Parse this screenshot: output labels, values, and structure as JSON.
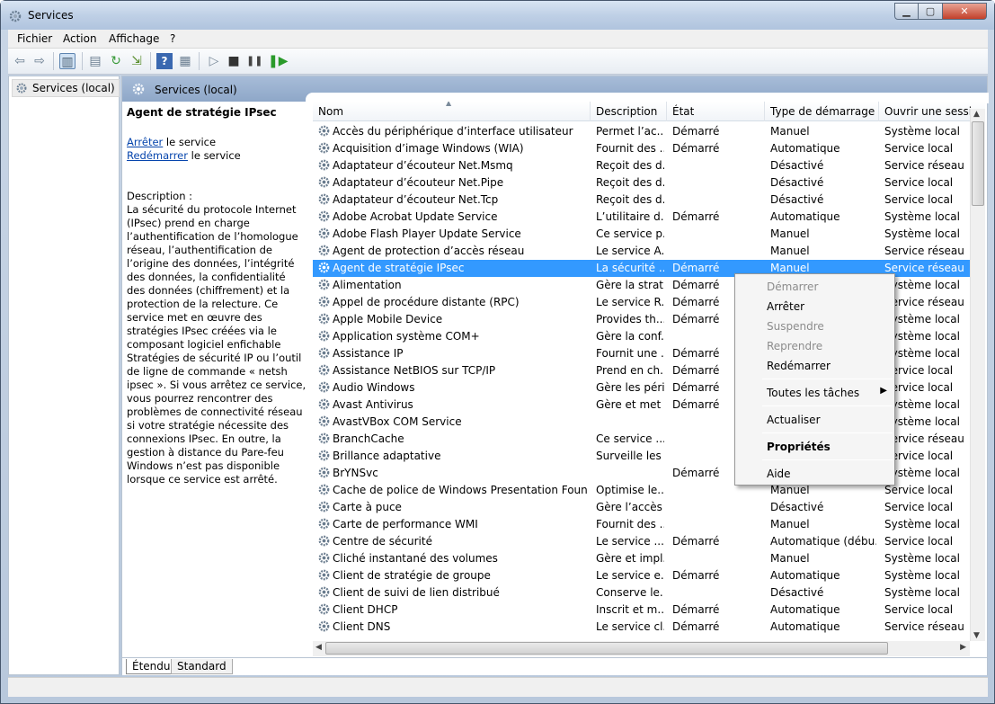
{
  "window": {
    "title": "Services",
    "icon": "gear-icon"
  },
  "menu": [
    "Fichier",
    "Action",
    "Affichage",
    "?"
  ],
  "toolbar": {
    "buttons": [
      "back-arrow-icon",
      "forward-arrow-icon",
      "console-tree-icon",
      "properties-icon",
      "refresh-icon",
      "export-icon",
      "help-icon",
      "view-icon",
      "play-icon",
      "stop-icon",
      "pause-icon",
      "restart-icon"
    ]
  },
  "tree": {
    "item": "Services (local)"
  },
  "pane_header": "Services (local)",
  "detail": {
    "title": "Agent de stratégie IPsec",
    "stop_link": "Arrêter",
    "stop_suffix": " le service",
    "restart_link": "Redémarrer",
    "restart_suffix": " le service",
    "description_label": "Description :",
    "description": "La sécurité du protocole Internet (IPsec) prend en charge l’authentification de l’homologue réseau, l’authentification de l’origine des données, l’intégrité des données, la confidentialité des données (chiffrement) et la protection de la relecture. Ce service met en œuvre des stratégies IPsec créées via le composant logiciel enfichable Stratégies de sécurité IP ou l’outil de ligne de commande « netsh ipsec ». Si vous arrêtez ce service, vous pourrez rencontrer des problèmes de connectivité réseau si votre stratégie nécessite des connexions IPsec. En outre, la gestion à distance du Pare-feu Windows n’est pas disponible lorsque ce service est arrêté."
  },
  "columns": [
    "Nom",
    "Description",
    "État",
    "Type de démarrage",
    "Ouvrir une session"
  ],
  "rows": [
    {
      "name": "Accès du périphérique d’interface utilisateur",
      "desc": "Permet l’ac...",
      "state": "Démarré",
      "startup": "Manuel",
      "logon": "Système local"
    },
    {
      "name": "Acquisition d’image Windows (WIA)",
      "desc": "Fournit des ...",
      "state": "Démarré",
      "startup": "Automatique",
      "logon": "Service local"
    },
    {
      "name": "Adaptateur d’écouteur Net.Msmq",
      "desc": "Reçoit des d...",
      "state": "",
      "startup": "Désactivé",
      "logon": "Service réseau"
    },
    {
      "name": "Adaptateur d’écouteur Net.Pipe",
      "desc": "Reçoit des d...",
      "state": "",
      "startup": "Désactivé",
      "logon": "Service local"
    },
    {
      "name": "Adaptateur d’écouteur Net.Tcp",
      "desc": "Reçoit des d...",
      "state": "",
      "startup": "Désactivé",
      "logon": "Service local"
    },
    {
      "name": "Adobe Acrobat Update Service",
      "desc": "L’utilitaire d...",
      "state": "Démarré",
      "startup": "Automatique",
      "logon": "Système local"
    },
    {
      "name": "Adobe Flash Player Update Service",
      "desc": "Ce service p...",
      "state": "",
      "startup": "Manuel",
      "logon": "Système local"
    },
    {
      "name": "Agent de protection d’accès réseau",
      "desc": "Le service A...",
      "state": "",
      "startup": "Manuel",
      "logon": "Service réseau"
    },
    {
      "name": "Agent de stratégie IPsec",
      "desc": "La sécurité ...",
      "state": "Démarré",
      "startup": "Manuel",
      "logon": "Service réseau"
    },
    {
      "name": "Alimentation",
      "desc": "Gère la strat...",
      "state": "Démarré",
      "startup": "",
      "logon": "Système local"
    },
    {
      "name": "Appel de procédure distante (RPC)",
      "desc": "Le service R...",
      "state": "Démarré",
      "startup": "",
      "logon": "Service réseau"
    },
    {
      "name": "Apple Mobile Device",
      "desc": "Provides th...",
      "state": "Démarré",
      "startup": "",
      "logon": "Système local"
    },
    {
      "name": "Application système COM+",
      "desc": "Gère la conf...",
      "state": "",
      "startup": "",
      "logon": "Système local"
    },
    {
      "name": "Assistance IP",
      "desc": "Fournit une ...",
      "state": "Démarré",
      "startup": "",
      "logon": "Système local"
    },
    {
      "name": "Assistance NetBIOS sur TCP/IP",
      "desc": "Prend en ch...",
      "state": "Démarré",
      "startup": "",
      "logon": "Service local"
    },
    {
      "name": "Audio Windows",
      "desc": "Gère les péri...",
      "state": "Démarré",
      "startup": "",
      "logon": "Service local"
    },
    {
      "name": "Avast Antivirus",
      "desc": "Gère et met ...",
      "state": "Démarré",
      "startup": "",
      "logon": "Système local"
    },
    {
      "name": "AvastVBox COM Service",
      "desc": "",
      "state": "",
      "startup": "",
      "logon": "Système local"
    },
    {
      "name": "BranchCache",
      "desc": "Ce service ...",
      "state": "",
      "startup": "",
      "logon": "Service réseau"
    },
    {
      "name": "Brillance adaptative",
      "desc": "Surveille les ...",
      "state": "",
      "startup": "",
      "logon": "Service local"
    },
    {
      "name": "BrYNSvc",
      "desc": "",
      "state": "Démarré",
      "startup": "",
      "logon": "Système local"
    },
    {
      "name": "Cache de police de Windows Presentation Foundati...",
      "desc": "Optimise le...",
      "state": "",
      "startup": "Manuel",
      "logon": "Service local"
    },
    {
      "name": "Carte à puce",
      "desc": "Gère l’accès ...",
      "state": "",
      "startup": "Désactivé",
      "logon": "Service local"
    },
    {
      "name": "Carte de performance WMI",
      "desc": "Fournit des ...",
      "state": "",
      "startup": "Manuel",
      "logon": "Système local"
    },
    {
      "name": "Centre de sécurité",
      "desc": "Le service ...",
      "state": "Démarré",
      "startup": "Automatique (débu...",
      "logon": "Service local"
    },
    {
      "name": "Cliché instantané des volumes",
      "desc": "Gère et impl...",
      "state": "",
      "startup": "Manuel",
      "logon": "Système local"
    },
    {
      "name": "Client de stratégie de groupe",
      "desc": "Le service e...",
      "state": "Démarré",
      "startup": "Automatique",
      "logon": "Système local"
    },
    {
      "name": "Client de suivi de lien distribué",
      "desc": "Conserve le...",
      "state": "",
      "startup": "Désactivé",
      "logon": "Système local"
    },
    {
      "name": "Client DHCP",
      "desc": "Inscrit et m...",
      "state": "Démarré",
      "startup": "Automatique",
      "logon": "Service local"
    },
    {
      "name": "Client DNS",
      "desc": "Le service cl...",
      "state": "Démarré",
      "startup": "Automatique",
      "logon": "Service réseau"
    }
  ],
  "selected_row_index": 8,
  "context_menu": {
    "items": [
      {
        "label": "Démarrer",
        "disabled": true
      },
      {
        "label": "Arrêter",
        "disabled": false
      },
      {
        "label": "Suspendre",
        "disabled": true
      },
      {
        "label": "Reprendre",
        "disabled": true
      },
      {
        "label": "Redémarrer",
        "disabled": false
      },
      {
        "label": "Toutes les tâches",
        "disabled": false,
        "submenu": true
      },
      {
        "label": "Actualiser",
        "disabled": false
      },
      {
        "label": "Propriétés",
        "disabled": false,
        "bold": true
      },
      {
        "label": "Aide",
        "disabled": false
      }
    ]
  },
  "bottom_tabs": [
    "Étendu",
    "Standard"
  ],
  "colors": {
    "selection": "#3399ff",
    "header": "#98b0d0",
    "link": "#0645ad"
  }
}
